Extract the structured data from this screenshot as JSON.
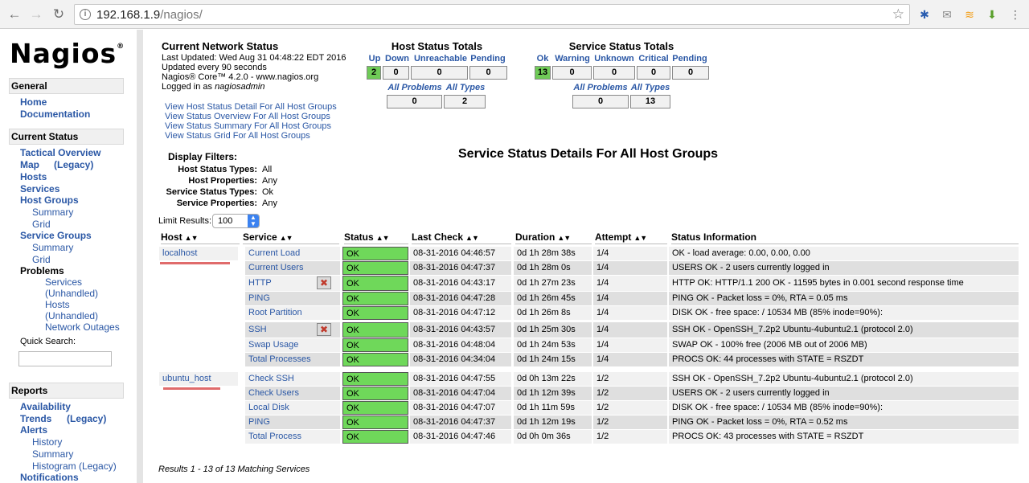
{
  "browser": {
    "url_host": "192.168.1.9",
    "url_path": "/nagios/"
  },
  "sidebar": {
    "logo": "Nagios",
    "logo_mark": "®",
    "general_title": "General",
    "home": "Home",
    "documentation": "Documentation",
    "current_status_title": "Current Status",
    "tactical_overview": "Tactical Overview",
    "map": "Map",
    "map_legacy": "(Legacy)",
    "hosts": "Hosts",
    "services": "Services",
    "host_groups": "Host Groups",
    "hg_summary": "Summary",
    "hg_grid": "Grid",
    "service_groups": "Service Groups",
    "sg_summary": "Summary",
    "sg_grid": "Grid",
    "problems": "Problems",
    "p_services": "Services",
    "p_unhandled1": "(Unhandled)",
    "p_hosts": "Hosts",
    "p_unhandled2": "(Unhandled)",
    "p_network_outages": "Network Outages",
    "quick_search": "Quick Search:",
    "reports_title": "Reports",
    "availability": "Availability",
    "trends": "Trends",
    "trends_legacy": "(Legacy)",
    "alerts": "Alerts",
    "a_history": "History",
    "a_summary": "Summary",
    "a_histogram": "Histogram (Legacy)",
    "notifications": "Notifications"
  },
  "status_header": {
    "title": "Current Network Status",
    "last_updated": "Last Updated: Wed Aug 31 04:48:22 EDT 2016",
    "update_interval": "Updated every 90 seconds",
    "version": "Nagios® Core™ 4.2.0 - www.nagios.org",
    "logged_in_prefix": "Logged in as",
    "logged_in_user": "nagiosadmin",
    "links": [
      "View Host Status Detail For All Host Groups",
      "View Status Overview For All Host Groups",
      "View Status Summary For All Host Groups",
      "View Status Grid For All Host Groups"
    ]
  },
  "host_totals": {
    "title": "Host Status Totals",
    "labels": [
      "Up",
      "Down",
      "Unreachable",
      "Pending"
    ],
    "values": [
      "2",
      "0",
      "0",
      "0"
    ],
    "all_problems_label": "All Problems",
    "all_types_label": "All Types",
    "all_problems": "0",
    "all_types": "2"
  },
  "service_totals": {
    "title": "Service Status Totals",
    "labels": [
      "Ok",
      "Warning",
      "Unknown",
      "Critical",
      "Pending"
    ],
    "values": [
      "13",
      "0",
      "0",
      "0",
      "0"
    ],
    "all_problems_label": "All Problems",
    "all_types_label": "All Types",
    "all_problems": "0",
    "all_types": "13"
  },
  "details_title": "Service Status Details For All Host Groups",
  "display_filters": {
    "title": "Display Filters:",
    "rows": [
      {
        "key": "Host Status Types:",
        "value": "All"
      },
      {
        "key": "Host Properties:",
        "value": "Any"
      },
      {
        "key": "Service Status Types:",
        "value": "Ok"
      },
      {
        "key": "Service Properties:",
        "value": "Any"
      }
    ]
  },
  "limit": {
    "label": "Limit Results:",
    "value": "100"
  },
  "table": {
    "headers": [
      "Host",
      "Service",
      "Status",
      "Last Check",
      "Duration",
      "Attempt",
      "Status Information"
    ],
    "hosts": [
      "localhost",
      "ubuntu_host"
    ],
    "rows": [
      {
        "host": "localhost",
        "service": "Current Load",
        "status": "OK",
        "last_check": "08-31-2016 04:46:57",
        "duration": "0d 1h 28m 38s",
        "attempt": "1/4",
        "info": "OK - load average: 0.00, 0.00, 0.00",
        "notif_disabled": false
      },
      {
        "host": "",
        "service": "Current Users",
        "status": "OK",
        "last_check": "08-31-2016 04:47:37",
        "duration": "0d 1h 28m 0s",
        "attempt": "1/4",
        "info": "USERS OK - 2 users currently logged in",
        "notif_disabled": false
      },
      {
        "host": "",
        "service": "HTTP",
        "status": "OK",
        "last_check": "08-31-2016 04:43:17",
        "duration": "0d 1h 27m 23s",
        "attempt": "1/4",
        "info": "HTTP OK: HTTP/1.1 200 OK - 11595 bytes in 0.001 second response time",
        "notif_disabled": true
      },
      {
        "host": "",
        "service": "PING",
        "status": "OK",
        "last_check": "08-31-2016 04:47:28",
        "duration": "0d 1h 26m 45s",
        "attempt": "1/4",
        "info": "PING OK - Packet loss = 0%, RTA = 0.05 ms",
        "notif_disabled": false
      },
      {
        "host": "",
        "service": "Root Partition",
        "status": "OK",
        "last_check": "08-31-2016 04:47:12",
        "duration": "0d 1h 26m 8s",
        "attempt": "1/4",
        "info": "DISK OK - free space: / 10534 MB (85% inode=90%):",
        "notif_disabled": false
      },
      {
        "host": "",
        "service": "SSH",
        "status": "OK",
        "last_check": "08-31-2016 04:43:57",
        "duration": "0d 1h 25m 30s",
        "attempt": "1/4",
        "info": "SSH OK - OpenSSH_7.2p2 Ubuntu-4ubuntu2.1 (protocol 2.0)",
        "notif_disabled": true
      },
      {
        "host": "",
        "service": "Swap Usage",
        "status": "OK",
        "last_check": "08-31-2016 04:48:04",
        "duration": "0d 1h 24m 53s",
        "attempt": "1/4",
        "info": "SWAP OK - 100% free (2006 MB out of 2006 MB)",
        "notif_disabled": false
      },
      {
        "host": "",
        "service": "Total Processes",
        "status": "OK",
        "last_check": "08-31-2016 04:34:04",
        "duration": "0d 1h 24m 15s",
        "attempt": "1/4",
        "info": "PROCS OK: 44 processes with STATE = RSZDT",
        "notif_disabled": false
      },
      {
        "host": "ubuntu_host",
        "service": "Check SSH",
        "status": "OK",
        "last_check": "08-31-2016 04:47:55",
        "duration": "0d 0h 13m 22s",
        "attempt": "1/2",
        "info": "SSH OK - OpenSSH_7.2p2 Ubuntu-4ubuntu2.1 (protocol 2.0)",
        "notif_disabled": false
      },
      {
        "host": "",
        "service": "Check Users",
        "status": "OK",
        "last_check": "08-31-2016 04:47:04",
        "duration": "0d 1h 12m 39s",
        "attempt": "1/2",
        "info": "USERS OK - 2 users currently logged in",
        "notif_disabled": false
      },
      {
        "host": "",
        "service": "Local Disk",
        "status": "OK",
        "last_check": "08-31-2016 04:47:07",
        "duration": "0d 1h 11m 59s",
        "attempt": "1/2",
        "info": "DISK OK - free space: / 10534 MB (85% inode=90%):",
        "notif_disabled": false
      },
      {
        "host": "",
        "service": "PING",
        "status": "OK",
        "last_check": "08-31-2016 04:47:37",
        "duration": "0d 1h 12m 19s",
        "attempt": "1/2",
        "info": "PING OK - Packet loss = 0%, RTA = 0.52 ms",
        "notif_disabled": false
      },
      {
        "host": "",
        "service": "Total Process",
        "status": "OK",
        "last_check": "08-31-2016 04:47:46",
        "duration": "0d 0h 0m 36s",
        "attempt": "1/2",
        "info": "PROCS OK: 43 processes with STATE = RSZDT",
        "notif_disabled": false
      }
    ]
  },
  "results_text": "Results 1 - 13 of 13 Matching Services"
}
